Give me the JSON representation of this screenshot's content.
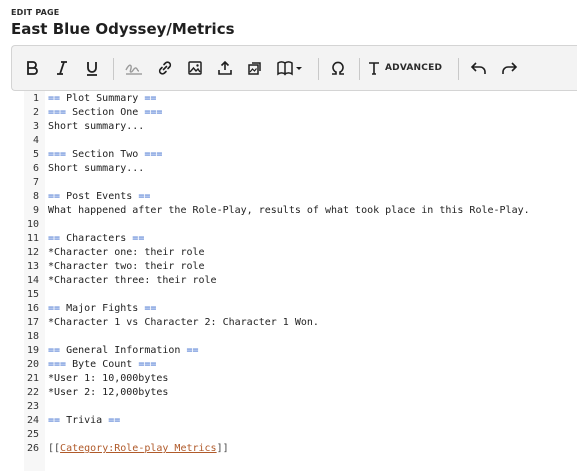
{
  "header": {
    "edit_label": "EDIT PAGE",
    "title": "East Blue Odyssey/Metrics"
  },
  "toolbar": {
    "advanced_label": "ADVANCED",
    "icons": [
      "bold-icon",
      "italic-icon",
      "underline-icon",
      "signature-icon",
      "link-icon",
      "image-icon",
      "upload-icon",
      "gallery-icon",
      "template-icon",
      "special-characters-icon",
      "text-format-icon",
      "undo-icon",
      "redo-icon"
    ]
  },
  "colors": {
    "heading_marker": "#3366cc",
    "link_text": "#b05a2a",
    "gutter_bg": "#f7f7f7",
    "toolbar_bg": "#f3f3f3"
  },
  "editor": {
    "lines": [
      {
        "num": "1",
        "open": "== ",
        "text": "Plot Summary",
        "close": " ==",
        "kind": "heading"
      },
      {
        "num": "2",
        "open": "=== ",
        "text": "Section One",
        "close": " ===",
        "kind": "heading"
      },
      {
        "num": "3",
        "text": "Short summary...",
        "kind": "text"
      },
      {
        "num": "4",
        "text": "",
        "kind": "text"
      },
      {
        "num": "5",
        "open": "=== ",
        "text": "Section Two",
        "close": " ===",
        "kind": "heading"
      },
      {
        "num": "6",
        "text": "Short summary...",
        "kind": "text"
      },
      {
        "num": "7",
        "text": "",
        "kind": "text"
      },
      {
        "num": "8",
        "open": "== ",
        "text": "Post Events",
        "close": " ==",
        "kind": "heading"
      },
      {
        "num": "9",
        "text": "What happened after the Role-Play, results of what took place in this Role-Play.",
        "kind": "text"
      },
      {
        "num": "10",
        "text": "",
        "kind": "text"
      },
      {
        "num": "11",
        "open": "== ",
        "text": "Characters",
        "close": " ==",
        "kind": "heading"
      },
      {
        "num": "12",
        "text": "*Character one: their role",
        "kind": "text"
      },
      {
        "num": "13",
        "text": "*Character two: their role",
        "kind": "text"
      },
      {
        "num": "14",
        "text": "*Character three: their role",
        "kind": "text"
      },
      {
        "num": "15",
        "text": "",
        "kind": "text"
      },
      {
        "num": "16",
        "open": "== ",
        "text": "Major Fights",
        "close": " ==",
        "kind": "heading"
      },
      {
        "num": "17",
        "text": "*Character 1 vs Character 2: Character 1 Won.",
        "kind": "text"
      },
      {
        "num": "18",
        "text": "",
        "kind": "text"
      },
      {
        "num": "19",
        "open": "== ",
        "text": "General Information",
        "close": " ==",
        "kind": "heading"
      },
      {
        "num": "20",
        "open": "=== ",
        "text": "Byte Count",
        "close": " ===",
        "kind": "heading"
      },
      {
        "num": "21",
        "text": "*User 1: 10,000bytes",
        "kind": "text"
      },
      {
        "num": "22",
        "text": "*User 2: 12,000bytes",
        "kind": "text"
      },
      {
        "num": "23",
        "text": "",
        "kind": "text"
      },
      {
        "num": "24",
        "open": "== ",
        "text": "Trivia",
        "close": " ==",
        "kind": "heading"
      },
      {
        "num": "25",
        "text": "",
        "kind": "text"
      },
      {
        "num": "26",
        "open": "[[",
        "text": "Category:Role-play Metrics",
        "close": "]]",
        "kind": "link"
      }
    ]
  }
}
